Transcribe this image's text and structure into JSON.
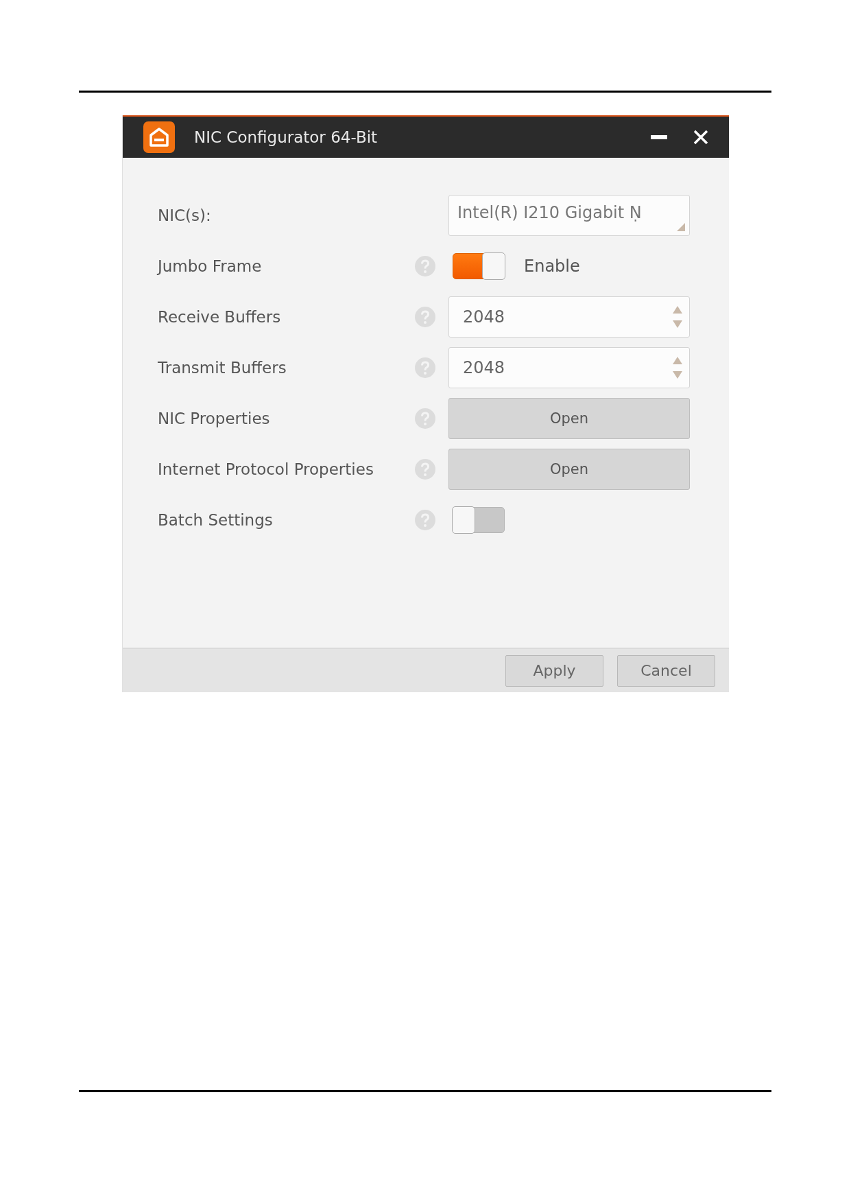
{
  "window": {
    "title": "NIC Configurator 64-Bit"
  },
  "rows": [
    {
      "kind": "dropdown",
      "label": "NIC(s):",
      "help": false,
      "value": "Intel(R) I210 Gigabit Ṇ"
    },
    {
      "kind": "toggle",
      "label": "Jumbo Frame",
      "help": true,
      "on": true,
      "state_label": "Enable"
    },
    {
      "kind": "spinner",
      "label": "Receive Buffers",
      "help": true,
      "value": "2048"
    },
    {
      "kind": "spinner",
      "label": "Transmit Buffers",
      "help": true,
      "value": "2048"
    },
    {
      "kind": "button",
      "label": "NIC Properties",
      "help": true,
      "button": "Open"
    },
    {
      "kind": "button",
      "label": "Internet Protocol Properties",
      "help": true,
      "button": "Open"
    },
    {
      "kind": "toggle",
      "label": "Batch Settings",
      "help": true,
      "on": false
    }
  ],
  "footer_buttons": [
    "Apply",
    "Cancel"
  ]
}
